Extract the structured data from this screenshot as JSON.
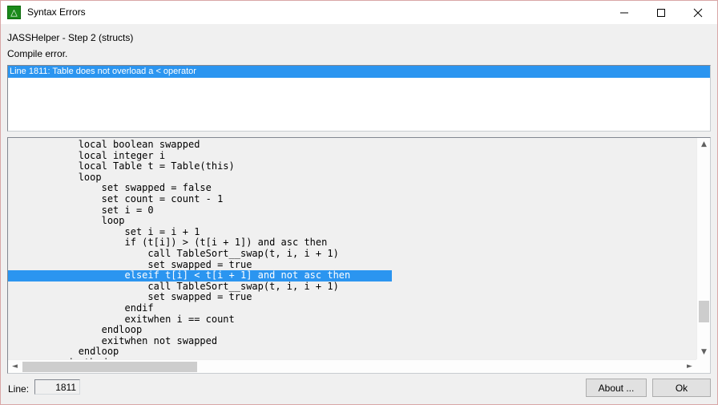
{
  "window": {
    "title": "Syntax Errors",
    "icon": "jasshelper-app-icon",
    "border_color": "#d9a6a6",
    "controls": {
      "minimize": "minimize-icon",
      "maximize": "maximize-icon",
      "close": "close-icon"
    }
  },
  "header": {
    "line1": "JASSHelper - Step 2 (structs)",
    "line2": "Compile error."
  },
  "error_list": {
    "selection_color": "#2b95f0",
    "items": [
      {
        "text": "Line 1811: Table does not overload a < operator",
        "selected": true
      }
    ]
  },
  "code": {
    "highlight_color": "#2b95f0",
    "selected_index": 12,
    "lines": [
      "            local boolean swapped",
      "            local integer i",
      "            local Table t = Table(this)",
      "            loop",
      "                set swapped = false",
      "                set count = count - 1",
      "                set i = 0",
      "                loop",
      "                    set i = i + 1",
      "                    if (t[i]) > (t[i + 1]) and asc then",
      "                        call TableSort__swap(t, i, i + 1)",
      "                        set swapped = true",
      "                    elseif t[i] < t[i + 1] and not asc then",
      "                        call TableSort__swap(t, i, i + 1)",
      "                        set swapped = true",
      "                    endif",
      "                    exitwhen i == count",
      "                endloop",
      "                exitwhen not swapped",
      "            endloop",
      "        endmethod"
    ],
    "vscrollbar": {
      "up_arrow": "chevron-up-icon",
      "down_arrow": "chevron-down-icon"
    },
    "hscrollbar": {
      "left_arrow": "chevron-left-icon",
      "right_arrow": "chevron-right-icon"
    }
  },
  "footer": {
    "line_label": "Line:",
    "line_value": "1811",
    "about_label": "About ...",
    "ok_label": "Ok"
  }
}
